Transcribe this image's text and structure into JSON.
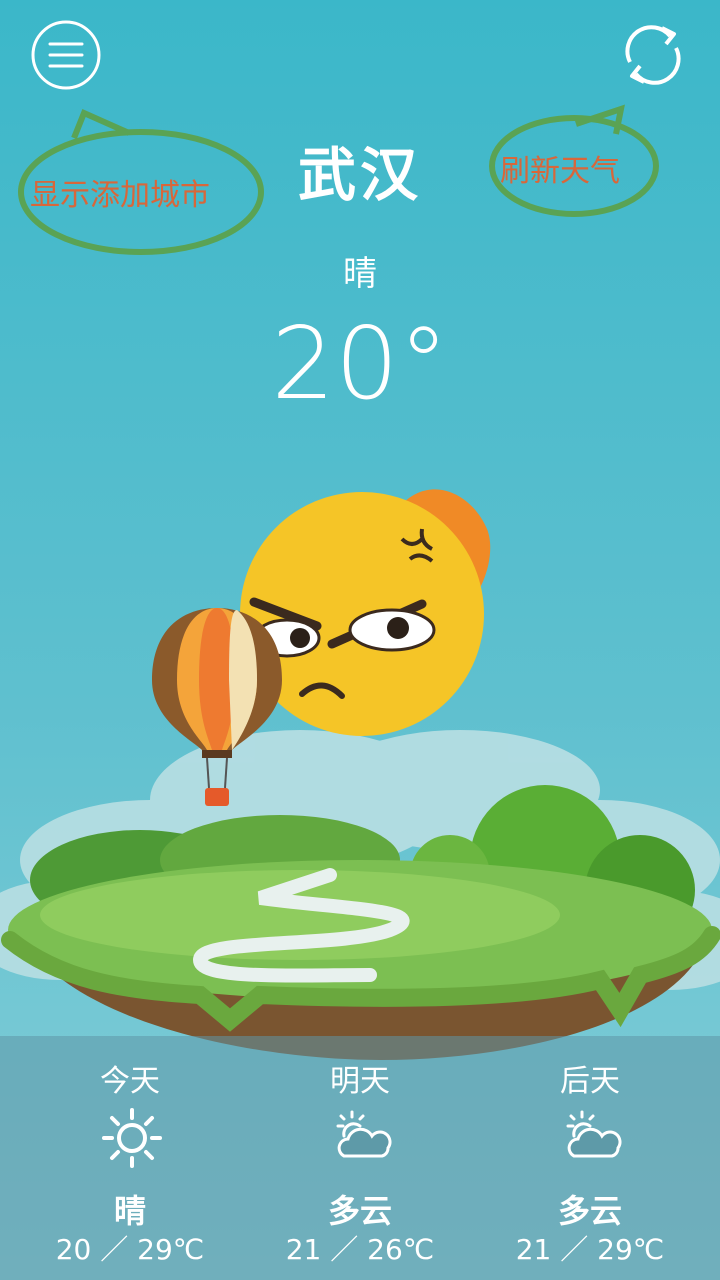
{
  "city": "武汉",
  "current": {
    "condition": "晴",
    "temperature": "20°"
  },
  "annotations": {
    "left": "显示添加城市",
    "right": "刷新天气"
  },
  "icons": {
    "menu": "menu-icon",
    "refresh": "refresh-icon"
  },
  "forecast": [
    {
      "day": "今天",
      "icon": "sun-icon",
      "condition": "晴",
      "temp": "20 ／ 29℃"
    },
    {
      "day": "明天",
      "icon": "partly-cloudy-icon",
      "condition": "多云",
      "temp": "21 ／ 26℃"
    },
    {
      "day": "后天",
      "icon": "partly-cloudy-icon",
      "condition": "多云",
      "temp": "21 ／ 29℃"
    }
  ]
}
